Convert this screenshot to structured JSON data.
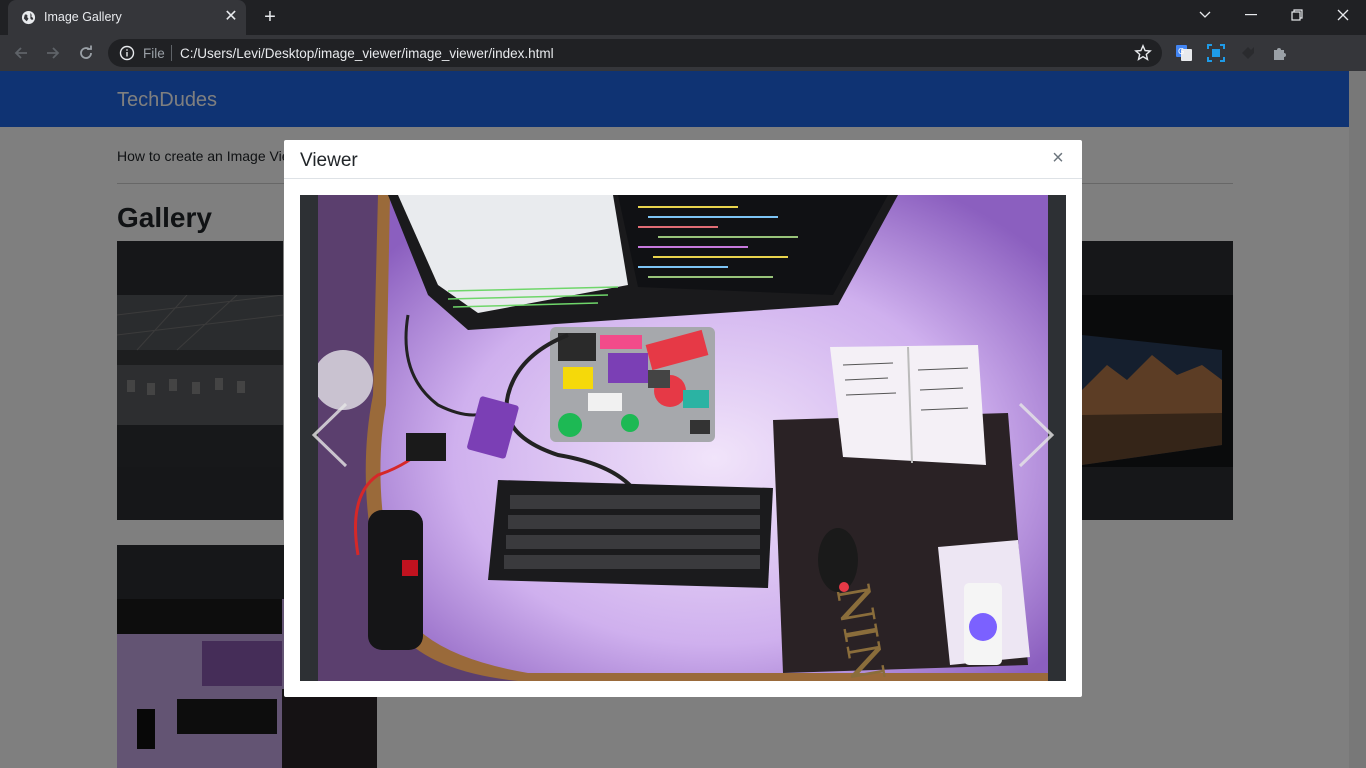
{
  "browser": {
    "tab_title": "Image Gallery",
    "url_scheme": "File",
    "url": "C:/Users/Levi/Desktop/image_viewer/image_viewer/index.html",
    "icons": [
      "globe-icon",
      "close-icon",
      "plus-icon",
      "chevron-down-icon",
      "minimize-icon",
      "restore-icon",
      "close-window-icon",
      "back-icon",
      "forward-icon",
      "reload-icon",
      "info-icon",
      "star-icon",
      "translate-icon",
      "screenshot-icon",
      "extension-icon",
      "puzzle-icon",
      "avatar",
      "menu-icon"
    ]
  },
  "page": {
    "brand": "TechDudes",
    "subtitle": "How to create an Image Vie",
    "gallery_title": "Gallery",
    "navbar_color": "#1e66e6"
  },
  "modal": {
    "title": "Viewer",
    "close_symbol": "×"
  }
}
